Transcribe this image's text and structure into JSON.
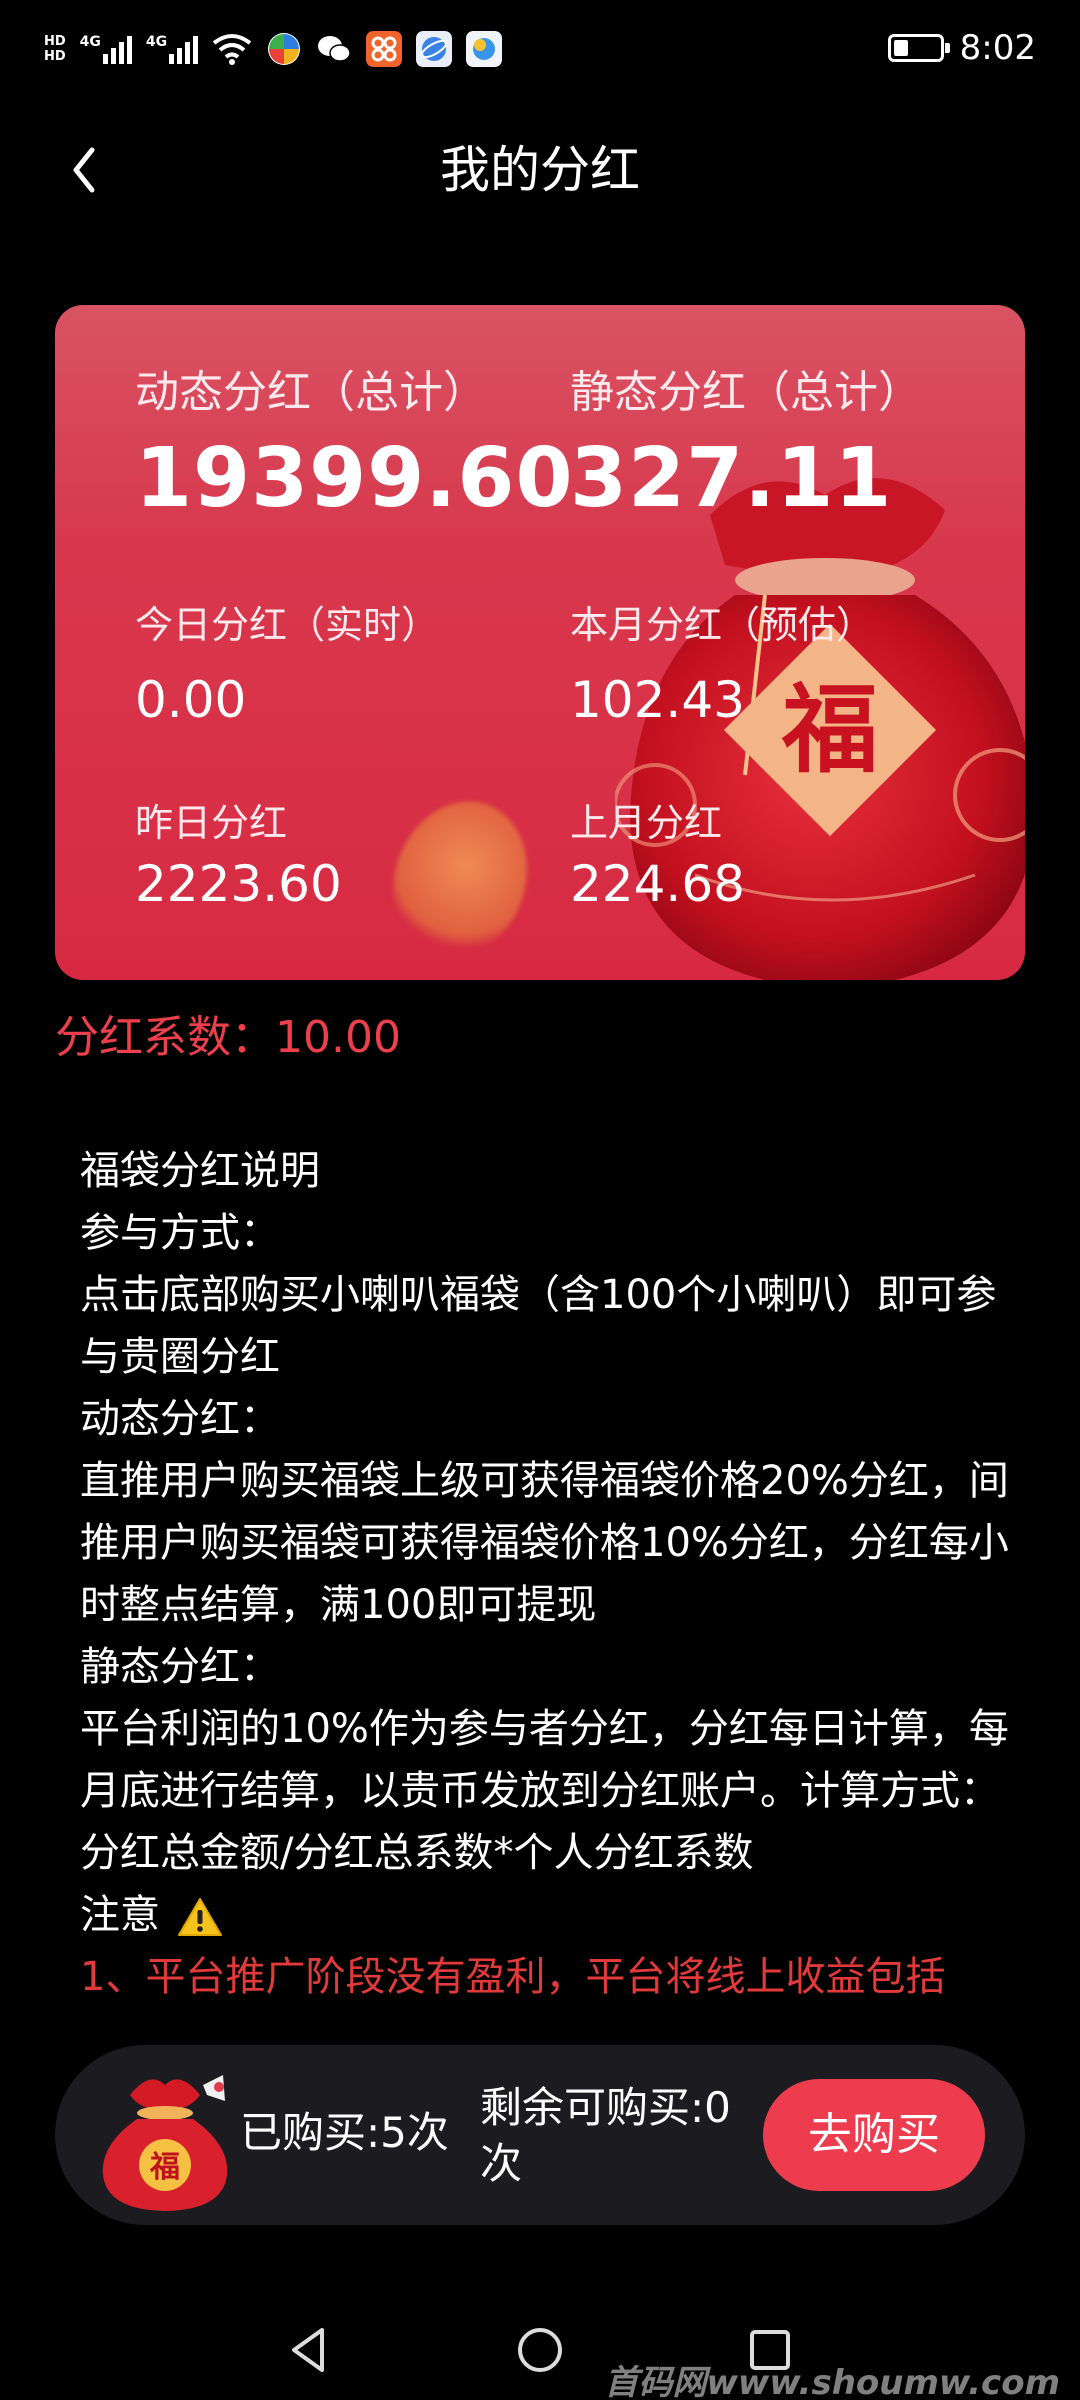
{
  "status_bar": {
    "hd_top": "HD",
    "hd_bottom": "HD",
    "network_1": "4G",
    "network_2": "4G",
    "time": "8:02",
    "icons": [
      "signal-icon",
      "wifi-icon",
      "app-pinwheel-icon",
      "wechat-icon",
      "app-orange-icon",
      "browser-icon",
      "app-sun-icon",
      "battery-icon"
    ]
  },
  "header": {
    "back_icon": "chevron-left-icon",
    "title": "我的分红"
  },
  "card": {
    "dynamic_label": "动态分红（总计）",
    "dynamic_value": "19399.60",
    "static_label": "静态分红（总计）",
    "static_value": "327.11",
    "today_label": "今日分红（实时）",
    "today_value": "0.00",
    "month_label": "本月分红（预估）",
    "month_value": "102.43",
    "yesterday_label": "昨日分红",
    "yesterday_value": "2223.60",
    "last_month_label": "上月分红",
    "last_month_value": "224.68",
    "bag_char": "福"
  },
  "coefficient": "分红系数：10.00",
  "description": {
    "title": "福袋分红说明",
    "join_heading": "参与方式：",
    "join_text": "点击底部购买小喇叭福袋（含100个小喇叭）即可参与贵圈分红",
    "dynamic_heading": "动态分红：",
    "dynamic_text": "直推用户购买福袋上级可获得福袋价格20%分红，间推用户购买福袋可获得福袋价格10%分红，分红每小时整点结算，满100即可提现",
    "static_heading": "静态分红：",
    "static_text": "平台利润的10%作为参与者分红，分红每日计算，每月底进行结算，以贵币发放到分红账户。计算方式：分红总金额/分红总系数*个人分红系数",
    "note_heading": "注意",
    "note_icon": "warning-icon",
    "note_text": "1、平台推广阶段没有盈利，平台将线上收益包括"
  },
  "buy_bar": {
    "bought": "已购买:5次",
    "remaining": "剩余可购买:0次",
    "button": "去购买",
    "bag_char": "福"
  },
  "nav": {
    "back": "back-triangle-icon",
    "home": "home-circle-icon",
    "recent": "recent-square-icon"
  },
  "watermark": "首码网www.shoumw.com"
}
